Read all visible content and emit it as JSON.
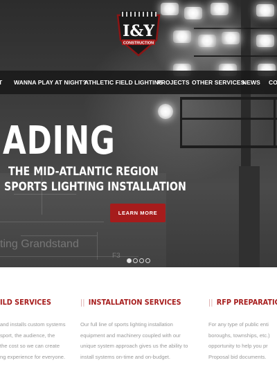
{
  "brand": {
    "logo_text": "I&Y",
    "logo_subtext": "CONSTRUCTION"
  },
  "nav": {
    "items": [
      {
        "label": "T"
      },
      {
        "label": "WANNA PLAY AT NIGHT?"
      },
      {
        "label": "ATHLETIC FIELD LIGHTING"
      },
      {
        "label": "PROJECTS"
      },
      {
        "label": "OTHER SERVICES"
      },
      {
        "label": "NEWS"
      },
      {
        "label": "CO"
      }
    ]
  },
  "hero": {
    "big_word": "ADING",
    "line1": "THE MID-ATLANTIC REGION",
    "line2": "SPORTS LIGHTING INSTALLATION",
    "cta_label": "LEARN MORE",
    "blueprint_text": "ting Grandstand",
    "blueprint_label": "F3",
    "slides": 4,
    "active_slide": 1
  },
  "services": [
    {
      "title": "ILD SERVICES",
      "lines": [
        "and installs custom systems",
        "sport, the audience, the",
        "the cost so we can create",
        "ng experience for everyone."
      ]
    },
    {
      "title": "INSTALLATION SERVICES",
      "lines": [
        "Our full line of sports lighting installation",
        "equipment and machinery coupled with our",
        "unique system approach gives us the ability to",
        "install systems on-time and on-budget."
      ]
    },
    {
      "title": "RFP PREPARATIONS",
      "lines": [
        "For any type of public enti",
        "boroughs, townships, etc.)",
        "opportunity to help you pr",
        "Proposal bid documents."
      ]
    }
  ],
  "colors": {
    "accent": "#a61c1c",
    "nav_bg": "#191919",
    "body_text": "#9a9a9a"
  }
}
